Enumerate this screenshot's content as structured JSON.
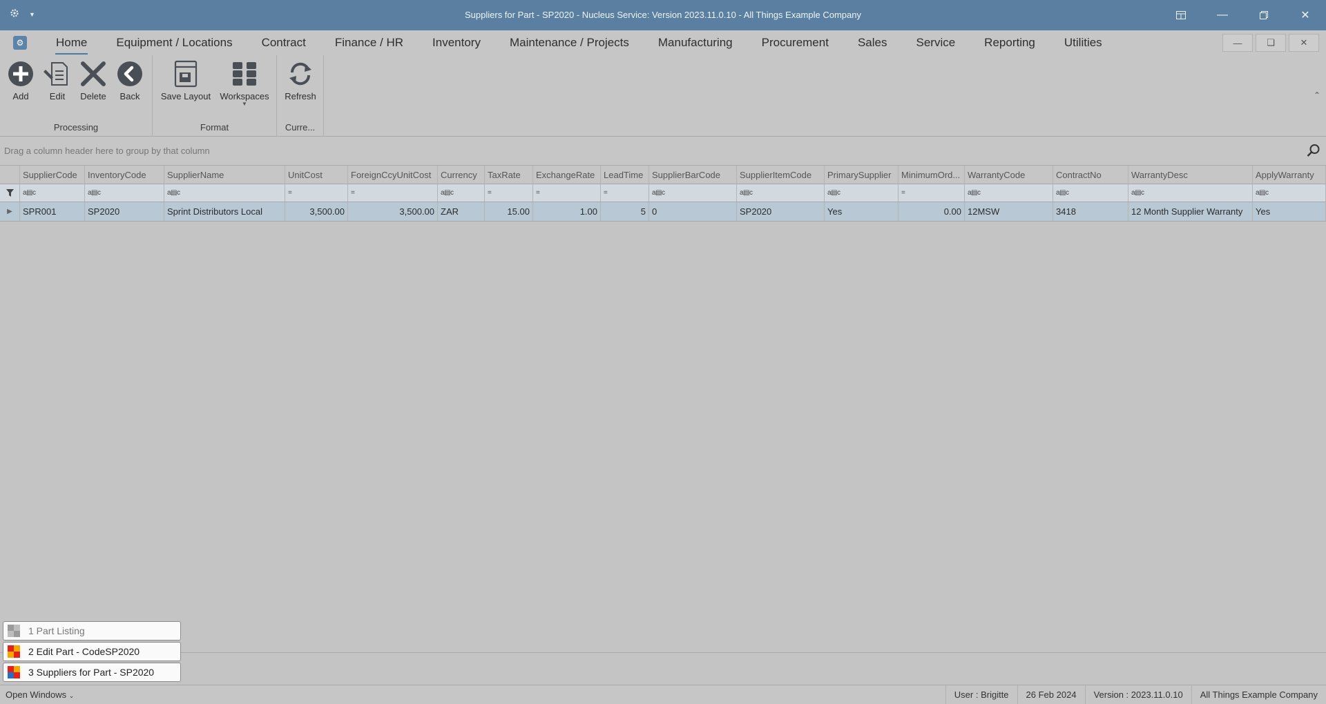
{
  "window": {
    "title": "Suppliers for Part - SP2020 - Nucleus Service: Version 2023.11.0.10 - All Things Example Company"
  },
  "menu": {
    "tabs": [
      "Home",
      "Equipment / Locations",
      "Contract",
      "Finance / HR",
      "Inventory",
      "Maintenance / Projects",
      "Manufacturing",
      "Procurement",
      "Sales",
      "Service",
      "Reporting",
      "Utilities"
    ]
  },
  "ribbon": {
    "groups": {
      "processing": "Processing",
      "format": "Format",
      "current": "Curre..."
    },
    "buttons": {
      "add": "Add",
      "edit": "Edit",
      "delete": "Delete",
      "back": "Back",
      "save_layout": "Save Layout",
      "workspaces": "Workspaces",
      "refresh": "Refresh"
    }
  },
  "grid": {
    "group_hint": "Drag a column header here to group by that column",
    "columns": [
      "SupplierCode",
      "InventoryCode",
      "SupplierName",
      "UnitCost",
      "ForeignCcyUnitCost",
      "Currency",
      "TaxRate",
      "ExchangeRate",
      "LeadTime",
      "SupplierBarCode",
      "SupplierItemCode",
      "PrimarySupplier",
      "MinimumOrd...",
      "WarrantyCode",
      "ContractNo",
      "WarrantyDesc",
      "ApplyWarranty"
    ],
    "rows": [
      [
        "SPR001",
        "SP2020",
        "Sprint Distributors Local",
        "3,500.00",
        "3,500.00",
        "ZAR",
        "15.00",
        "1.00",
        "5",
        "0",
        "SP2020",
        "Yes",
        "0.00",
        "12MSW",
        "3418",
        "12 Month Supplier Warranty",
        "Yes"
      ]
    ]
  },
  "open_windows": [
    "1 Part Listing",
    "2 Edit Part - CodeSP2020",
    "3 Suppliers for Part - SP2020"
  ],
  "status": {
    "open_windows_label": "Open Windows",
    "user": "User : Brigitte",
    "date": "26 Feb 2024",
    "version": "Version : 2023.11.0.10",
    "company": "All Things Example Company"
  }
}
